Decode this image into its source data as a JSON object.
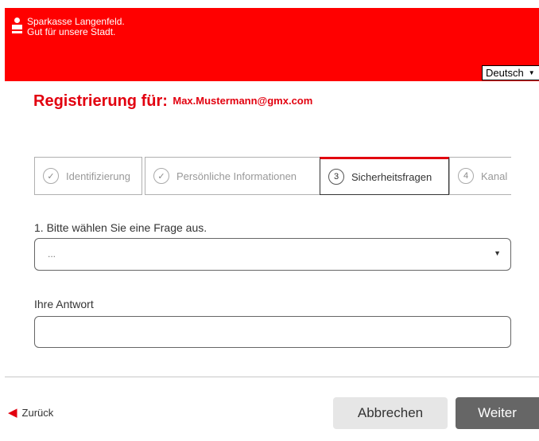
{
  "header": {
    "brand_line1": "Sparkasse Langenfeld.",
    "brand_line2": "Gut für unsere Stadt.",
    "language": "Deutsch",
    "accent_color": "#ff0000"
  },
  "registration": {
    "label": "Registrierung für:",
    "email": "Max.Mustermann@gmx.com"
  },
  "steps": [
    {
      "marker": "✓",
      "label": "Identifizierung",
      "state": "done"
    },
    {
      "marker": "✓",
      "label": "Persönliche Informationen",
      "state": "done"
    },
    {
      "marker": "3",
      "label": "Sicherheitsfragen",
      "state": "active"
    },
    {
      "marker": "4",
      "label": "Kanal",
      "state": "pending"
    }
  ],
  "form": {
    "question_label": "1. Bitte wählen Sie eine Frage aus.",
    "question_value": "...",
    "answer_label": "Ihre Antwort",
    "answer_value": ""
  },
  "footer": {
    "back_label": "Zurück",
    "cancel_label": "Abbrechen",
    "next_label": "Weiter"
  }
}
